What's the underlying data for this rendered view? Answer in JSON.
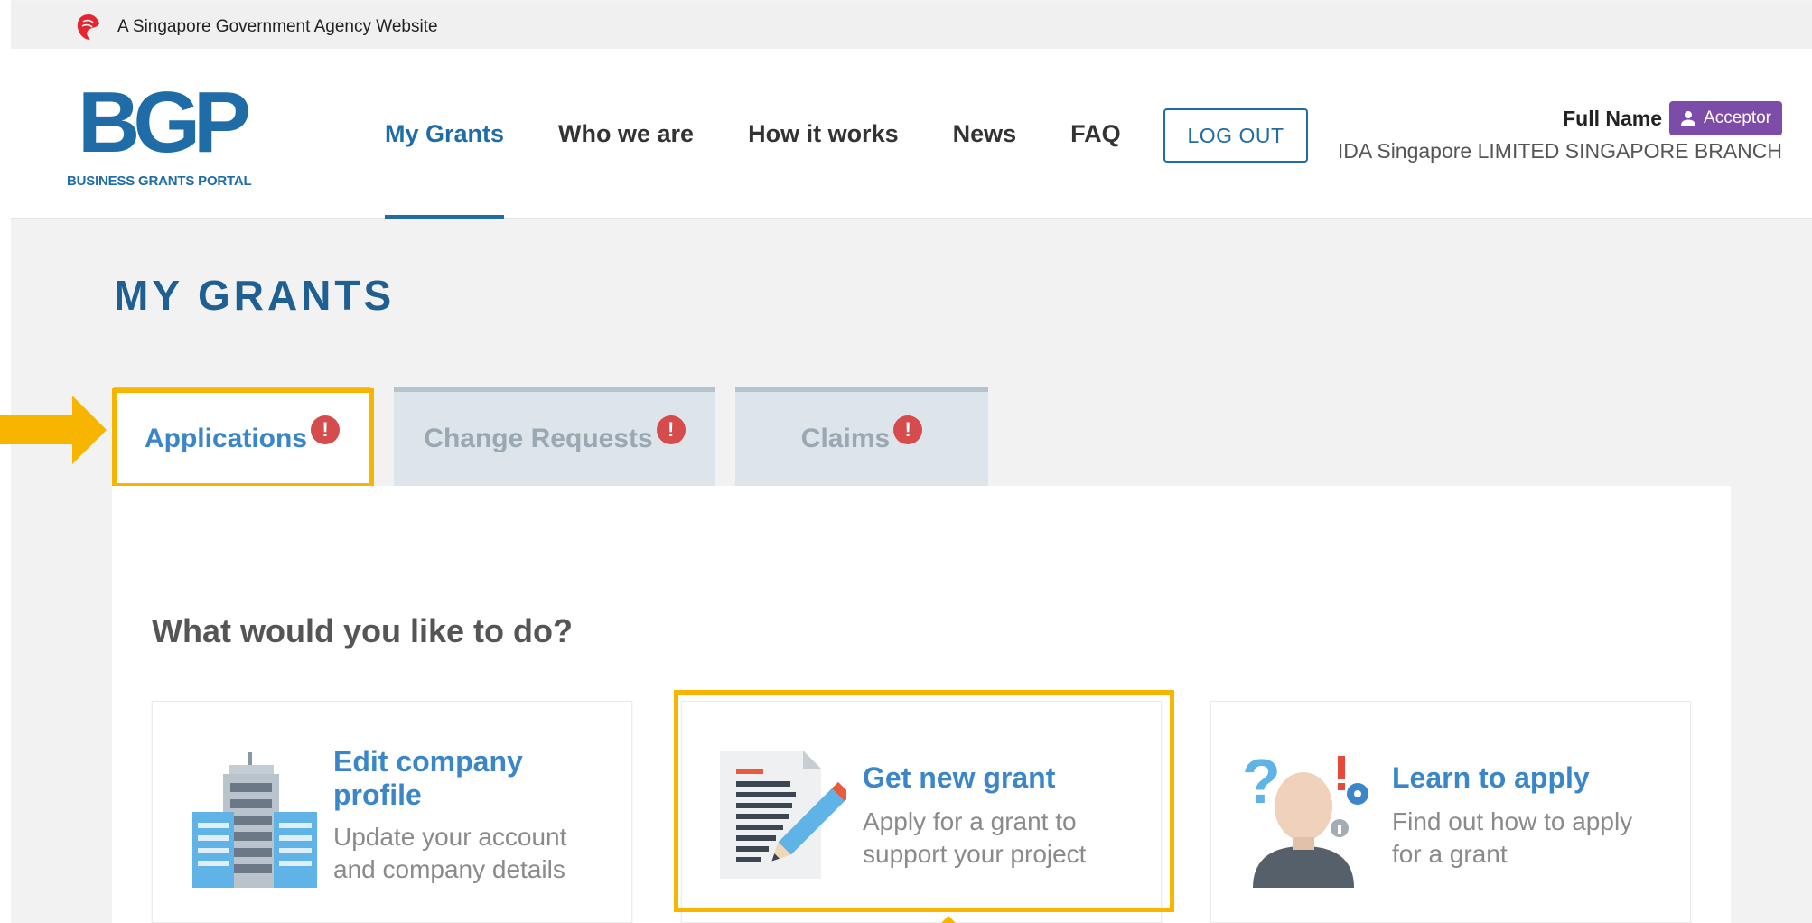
{
  "masthead": {
    "text": "A Singapore Government Agency Website"
  },
  "logo": {
    "mark": "BGP",
    "caption": "BUSINESS GRANTS PORTAL"
  },
  "nav": [
    {
      "label": "My Grants",
      "active": true
    },
    {
      "label": "Who we are",
      "active": false
    },
    {
      "label": "How it works",
      "active": false
    },
    {
      "label": "News",
      "active": false
    },
    {
      "label": "FAQ",
      "active": false
    }
  ],
  "logout_label": "LOG OUT",
  "user": {
    "name": "Full Name",
    "role": "Acceptor",
    "company": "IDA Singapore LIMITED SINGAPORE BRANCH"
  },
  "page_title": "MY GRANTS",
  "tabs": [
    {
      "label": "Applications",
      "alert": "!",
      "active": true
    },
    {
      "label": "Change Requests",
      "alert": "!",
      "active": false
    },
    {
      "label": "Claims",
      "alert": "!",
      "active": false
    }
  ],
  "question": "What would you like to do?",
  "cards": [
    {
      "title": "Edit company profile",
      "description": "Update your account and company details",
      "icon": "building-icon"
    },
    {
      "title": "Get new grant",
      "description": "Apply for a grant to support your project",
      "icon": "document-pencil-icon"
    },
    {
      "title": "Learn to apply",
      "description": "Find out how to apply for a grant",
      "icon": "question-person-icon"
    }
  ],
  "colors": {
    "brand": "#1f6ca6",
    "link": "#3a86c8",
    "badge": "#7d4ba8",
    "alert": "#d64b4b",
    "highlight": "#f7b500"
  }
}
